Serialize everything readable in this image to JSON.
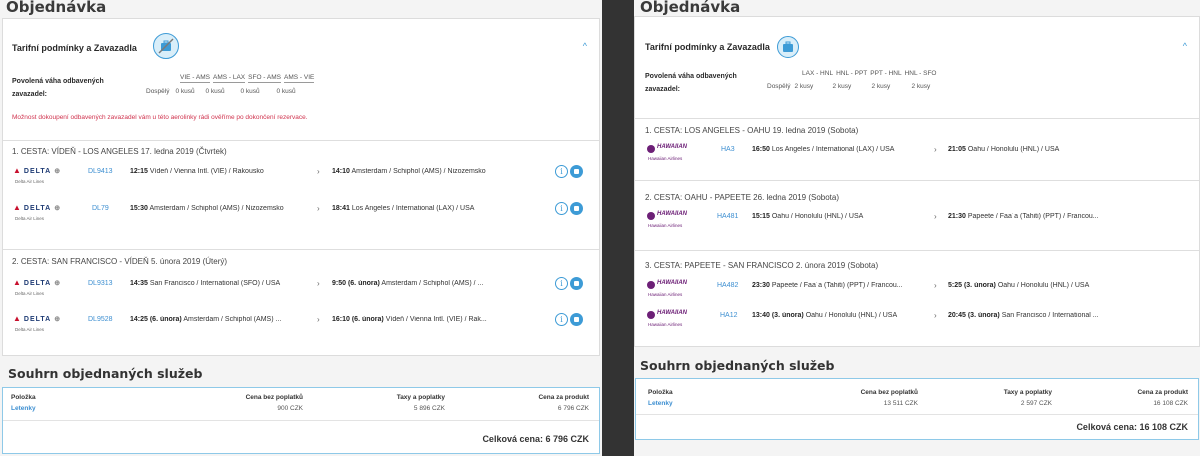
{
  "left": {
    "order_title": "Objednávka",
    "tariff_title": "Tarifní podmínky a Zavazadla",
    "weight_label_1": "Povolená váha odbavených",
    "weight_label_2": "zavazadel:",
    "routes": [
      "VIE - AMS",
      "AMS - LAX",
      "SFO - AMS",
      "AMS - VIE"
    ],
    "adult_label": "Dospělý",
    "allowances": [
      "0 kusů",
      "0 kusů",
      "0 kusů",
      "0 kusů"
    ],
    "warning": "Možnost dokoupení odbavených zavazadel vám u této aerolinky rádi ověříme po dokončení rezervace.",
    "legs": [
      {
        "header": "1. CESTA: VÍDEŇ - LOS ANGELES 17. ledna 2019 (Čtvrtek)",
        "flights": [
          {
            "airline": "DELTA",
            "airline_sub": "Delta Air Lines",
            "number": "DL9413",
            "dep_time": "12:15",
            "dep_place": "Vídeň / Vienna Intl. (VIE) / Rakousko",
            "arr_time": "14:10",
            "arr_place": "Amsterdam / Schiphol (AMS) / Nizozemsko"
          },
          {
            "airline": "DELTA",
            "airline_sub": "Delta Air Lines",
            "number": "DL79",
            "dep_time": "15:30",
            "dep_place": "Amsterdam / Schiphol (AMS) / Nizozemsko",
            "arr_time": "18:41",
            "arr_place": "Los Angeles / International (LAX) / USA"
          }
        ]
      },
      {
        "header": "2. CESTA: SAN FRANCISCO - VÍDEŇ 5. února 2019 (Úterý)",
        "flights": [
          {
            "airline": "DELTA",
            "airline_sub": "Delta Air Lines",
            "number": "DL9313",
            "dep_time": "14:35",
            "dep_place": "San Francisco / International (SFO) / USA",
            "arr_time": "9:50 (6. února)",
            "arr_place": "Amsterdam / Schiphol (AMS) / ..."
          },
          {
            "airline": "DELTA",
            "airline_sub": "Delta Air Lines",
            "number": "DL9528",
            "dep_time": "14:25 (6. února)",
            "dep_place": "Amsterdam / Schiphol (AMS) ...",
            "arr_time": "16:10 (6. února)",
            "arr_place": "Vídeň / Vienna Intl. (VIE) / Rak..."
          }
        ]
      }
    ],
    "summary_title": "Souhrn objednaných služeb",
    "summary_headers": [
      "Položka",
      "Cena bez poplatků",
      "Taxy a poplatky",
      "Cena za produkt"
    ],
    "summary_item": "Letenky",
    "summary_values": [
      "900 CZK",
      "5 896 CZK",
      "6 796 CZK"
    ],
    "total": "Celková cena: 6 796 CZK"
  },
  "right": {
    "order_title": "Objednávka",
    "tariff_title": "Tarifní podmínky a Zavazadla",
    "weight_label_1": "Povolená váha odbavených",
    "weight_label_2": "zavazadel:",
    "routes": [
      "LAX - HNL",
      "HNL - PPT",
      "PPT - HNL",
      "HNL - SFO"
    ],
    "adult_label": "Dospělý",
    "allowances": [
      "2 kusy",
      "2 kusy",
      "2 kusy",
      "2 kusy"
    ],
    "legs": [
      {
        "header": "1. CESTA: LOS ANGELES - OAHU 19. ledna 2019 (Sobota)",
        "flights": [
          {
            "airline": "HAWAIIAN",
            "airline_sub": "Hawaiian Airlines",
            "number": "HA3",
            "dep_time": "16:50",
            "dep_place": "Los Angeles / International (LAX) / USA",
            "arr_time": "21:05",
            "arr_place": "Oahu / Honolulu (HNL) / USA"
          }
        ]
      },
      {
        "header": "2. CESTA: OAHU - PAPEETE 26. ledna 2019 (Sobota)",
        "flights": [
          {
            "airline": "HAWAIIAN",
            "airline_sub": "Hawaiian Airlines",
            "number": "HA481",
            "dep_time": "15:15",
            "dep_place": "Oahu / Honolulu (HNL) / USA",
            "arr_time": "21:30",
            "arr_place": "Papeete / Faa´a (Tahiti) (PPT) / Francou..."
          }
        ]
      },
      {
        "header": "3. CESTA: PAPEETE - SAN FRANCISCO 2. února 2019 (Sobota)",
        "flights": [
          {
            "airline": "HAWAIIAN",
            "airline_sub": "Hawaiian Airlines",
            "number": "HA482",
            "dep_time": "23:30",
            "dep_place": "Papeete / Faa´a (Tahiti) (PPT) / Francou...",
            "arr_time": "5:25 (3. února)",
            "arr_place": "Oahu / Honolulu (HNL) / USA"
          },
          {
            "airline": "HAWAIIAN",
            "airline_sub": "Hawaiian Airlines",
            "number": "HA12",
            "dep_time": "13:40 (3. února)",
            "dep_place": "Oahu / Honolulu (HNL) / USA",
            "arr_time": "20:45 (3. února)",
            "arr_place": "San Francisco / International ..."
          }
        ]
      }
    ],
    "summary_title": "Souhrn objednaných služeb",
    "summary_headers": [
      "Položka",
      "Cena bez poplatků",
      "Taxy a poplatky",
      "Cena za produkt"
    ],
    "summary_item": "Letenky",
    "summary_values": [
      "13 511 CZK",
      "2 597 CZK",
      "16 108 CZK"
    ],
    "total": "Celková cena: 16 108 CZK"
  },
  "colors": {
    "accent": "#3d9bd6",
    "warning": "#d0334e",
    "delta_navy": "#1e3b74",
    "delta_red": "#c8102e",
    "hawaiian_purple": "#6d2077"
  }
}
